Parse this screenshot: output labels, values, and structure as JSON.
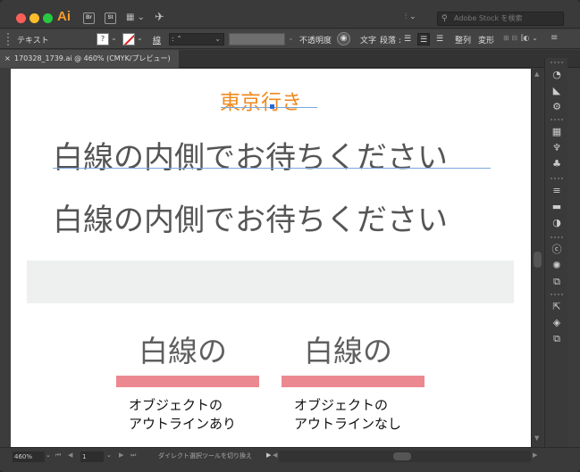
{
  "app": {
    "logo": "Ai",
    "bridge_label": "Br",
    "stock_label": "St",
    "arrange_icon": "▦ ⌄",
    "gpu_icon": "rocket-icon",
    "workspace_switcher": "⫶ ⌄",
    "stock_search_placeholder": "Adobe Stock を検索"
  },
  "control_bar": {
    "selection_label": "テキスト",
    "fill_label": "?",
    "stroke_label": "線",
    "stroke_weight": ": ⌃",
    "opacity_label": "不透明度",
    "recolor_icon": "◉",
    "character_label": "文字",
    "paragraph_label": "段落 :",
    "arrange_label": "整列",
    "transform_label": "変形",
    "misc1": "⊞ ⊟",
    "misc2": "⫿◐ ⌄",
    "menu_icon": "≡"
  },
  "document_tab": {
    "title": "170328_1739.ai @ 460% (CMYK/プレビュー)",
    "close": "×"
  },
  "artboard": {
    "title": "東京行き",
    "line1": "白線の内側でお待ちください",
    "line2": "白線の内側でお待ちください",
    "sample_left": "白線の",
    "sample_right": "白線の",
    "caption_left": [
      "オブジェクトの",
      "アウトラインあり"
    ],
    "caption_right": [
      "オブジェクトの",
      "アウトラインなし"
    ],
    "colors": {
      "title": "#ef8a1f",
      "text": "#555555",
      "band": "#eeefef",
      "underline_bar": "#ec8990"
    }
  },
  "dock": {
    "icons": [
      "color-guide-icon",
      "gradient-icon",
      "appearance-icon",
      "swatches-icon",
      "brushes-icon",
      "symbols-icon",
      "stroke-icon",
      "transparency-icon",
      "layers-icon",
      "cc-libraries-icon",
      "asset-export-icon",
      "artboards-icon",
      "links-icon",
      "arrange-panel-icon",
      "pathfinder-icon"
    ],
    "glyphs": [
      "◔",
      "◣",
      "⚙",
      "▦",
      "♆",
      "♣",
      "≡",
      "▬",
      "◑",
      "ⓒ",
      "✺",
      "⧉",
      "⇱",
      "◈",
      "⧉"
    ]
  },
  "status_bar": {
    "zoom": "460%",
    "page": "1",
    "status_text": "ダイレクト選択ツールを切り換え",
    "status_arrow": "▶"
  }
}
